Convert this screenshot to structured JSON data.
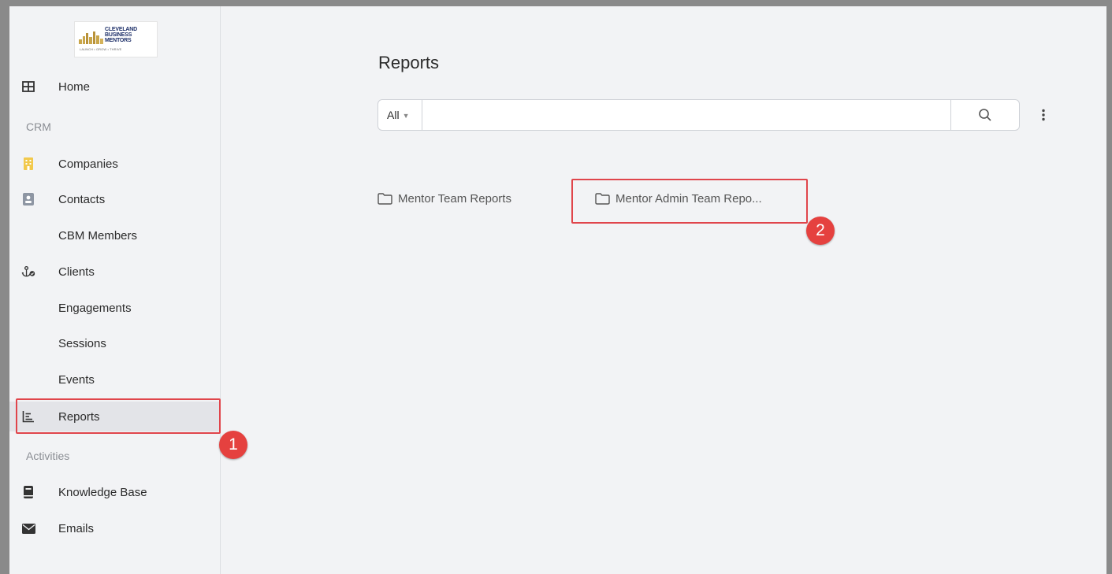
{
  "logo": {
    "line1": "CLEVELAND",
    "line2": "BUSINESS",
    "line3": "MENTORS",
    "tagline": "LAUNCH • GROW • THRIVE"
  },
  "sidebar": {
    "home": {
      "label": "Home",
      "icon": "grid-icon"
    },
    "section_crm": "CRM",
    "companies": {
      "label": "Companies",
      "icon": "building-icon",
      "color": "#f2c94c"
    },
    "contacts": {
      "label": "Contacts",
      "icon": "contact-card-icon",
      "color": "#8e96a3"
    },
    "cbm_members": {
      "label": "CBM Members"
    },
    "clients": {
      "label": "Clients",
      "icon": "anchor-icon"
    },
    "engagements": {
      "label": "Engagements"
    },
    "sessions": {
      "label": "Sessions"
    },
    "events": {
      "label": "Events"
    },
    "reports": {
      "label": "Reports",
      "icon": "bar-chart-icon"
    },
    "section_activities": "Activities",
    "knowledge_base": {
      "label": "Knowledge Base",
      "icon": "book-icon"
    },
    "emails": {
      "label": "Emails",
      "icon": "envelope-icon"
    }
  },
  "main": {
    "title": "Reports",
    "search": {
      "filter_label": "All",
      "value": "",
      "placeholder": ""
    },
    "folders": [
      {
        "label": "Mentor Team Reports"
      },
      {
        "label": "Mentor Admin Team Repo..."
      }
    ]
  },
  "annotations": {
    "badge1": "1",
    "badge2": "2",
    "highlight_color": "#e0454b"
  }
}
